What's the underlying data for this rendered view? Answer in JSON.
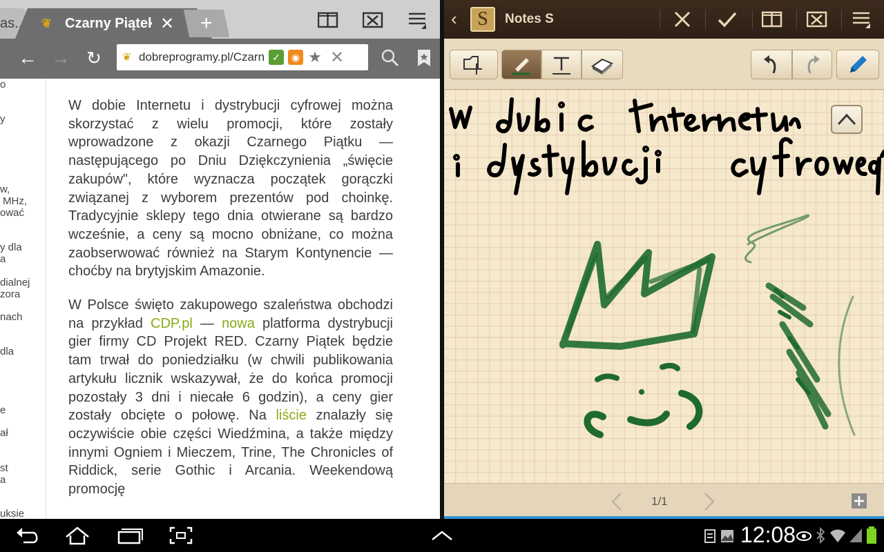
{
  "browser": {
    "tabs": [
      {
        "title": "as...",
        "active": false
      },
      {
        "title": "Czarny Piątek",
        "active": true
      }
    ],
    "new_tab_label": "+",
    "url": "dobreprogramy.pl/Czarny",
    "sidebar_fragments": [
      "o",
      "y",
      "w,",
      "MHz,",
      "ować",
      "y dla",
      "a",
      "dialnej",
      "zora",
      "nach",
      "dla",
      "e",
      "ał",
      "st",
      "a",
      "uksie"
    ],
    "article": {
      "paragraph1": "W dobie Internetu i dystrybucji cyfrowej można skorzystać z wielu promocji, które zostały wprowadzone z okazji Czarnego Piątku — następującego po Dniu Dziękczynienia „święcie zakupów\", które wyznacza początek gorączki związanej z wyborem prezentów pod choinkę. Tradycyjnie sklepy tego dnia otwierane są bardzo wcześnie, a ceny są mocno obniżane, co można zaobserwować również na Starym Kontynencie — choćby na brytyjskim Amazonie.",
      "p2_before_link1": "W Polsce święto zakupowego szaleństwa obchodzi na przykład ",
      "p2_link1": "CDP.pl",
      "p2_between": " — ",
      "p2_link2": "nowa",
      "p2_after_link2": " platforma dystrybucji gier firmy CD Projekt RED. Czarny Piątek będzie tam trwał do poniedziałku (w chwili publikowania artykułu licznik wskazywał, że do końca promocji pozostały 3 dni i niecałe 6 godzin), a ceny gier zostały obcięte o połowę. Na ",
      "p2_link3": "liście",
      "p2_end": " znalazły się oczywiście obie części Wiedźmina, a także między innymi Ogniem i Mieczem, Trine, The Chronicles of Riddick, serie Gothic i Arcania. Weekendową promocję"
    }
  },
  "notes": {
    "app_name": "Notes S",
    "page_indicator": "1/1",
    "pen_color": "#1e6b2c",
    "ink_color": "#000000"
  },
  "system": {
    "clock": "12:08"
  }
}
